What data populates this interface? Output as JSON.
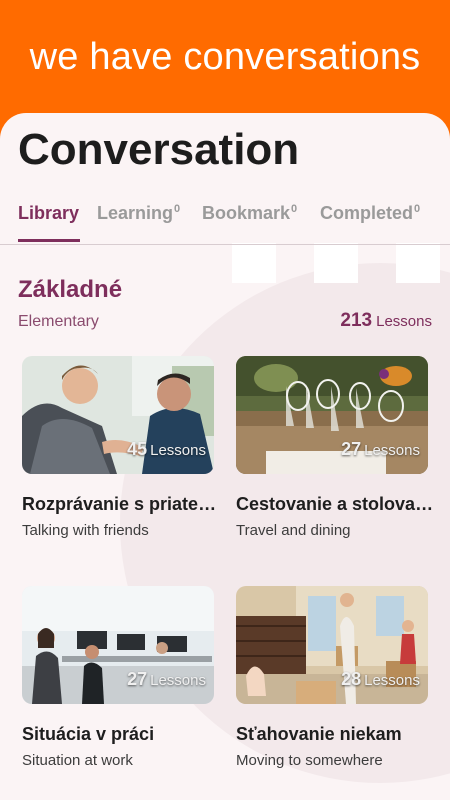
{
  "banner": {
    "text": "we have conversations"
  },
  "header": {
    "title": "Conversation"
  },
  "tabs": [
    {
      "label": "Library",
      "count": ""
    },
    {
      "label": "Learning",
      "count": "0"
    },
    {
      "label": "Bookmark",
      "count": "0"
    },
    {
      "label": "Completed",
      "count": "0"
    }
  ],
  "section": {
    "title": "Základné",
    "subtitle": "Elementary",
    "count": "213",
    "count_label": "Lessons"
  },
  "lessons": [
    {
      "count": "45",
      "count_label": "Lessons",
      "title": "Rozprávanie s priateľmi",
      "subtitle": "Talking with friends"
    },
    {
      "count": "27",
      "count_label": "Lessons",
      "title": "Cestovanie a stolovanie",
      "subtitle": "Travel and dining"
    },
    {
      "count": "27",
      "count_label": "Lessons",
      "title": "Situácia v práci",
      "subtitle": "Situation at work"
    },
    {
      "count": "28",
      "count_label": "Lessons",
      "title": "Sťahovanie niekam",
      "subtitle": "Moving to somewhere"
    }
  ],
  "colors": {
    "banner": "#ff6b00",
    "accent": "#7e2e5c",
    "card_bg": "#fbf4f5"
  }
}
